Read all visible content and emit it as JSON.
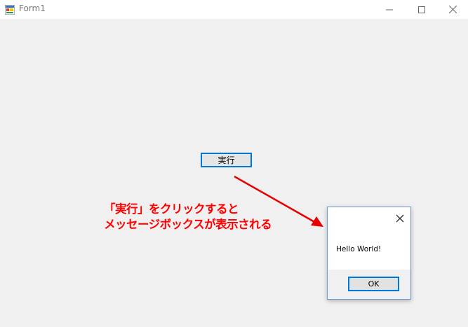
{
  "window": {
    "title": "Form1",
    "icon": "winforms-app-icon"
  },
  "title_controls": {
    "minimize": "minimize-icon",
    "maximize": "maximize-icon",
    "close": "close-icon"
  },
  "form": {
    "run_button_label": "実行"
  },
  "annotation": {
    "line1": "「実行」をクリックすると",
    "line2": "メッセージボックスが表示される",
    "color": "#ff0000"
  },
  "message_box": {
    "text": "Hello World!",
    "ok_label": "OK",
    "close_icon": "close-icon"
  },
  "colors": {
    "accent": "#0078d7",
    "form_bg": "#f0f0f0"
  }
}
